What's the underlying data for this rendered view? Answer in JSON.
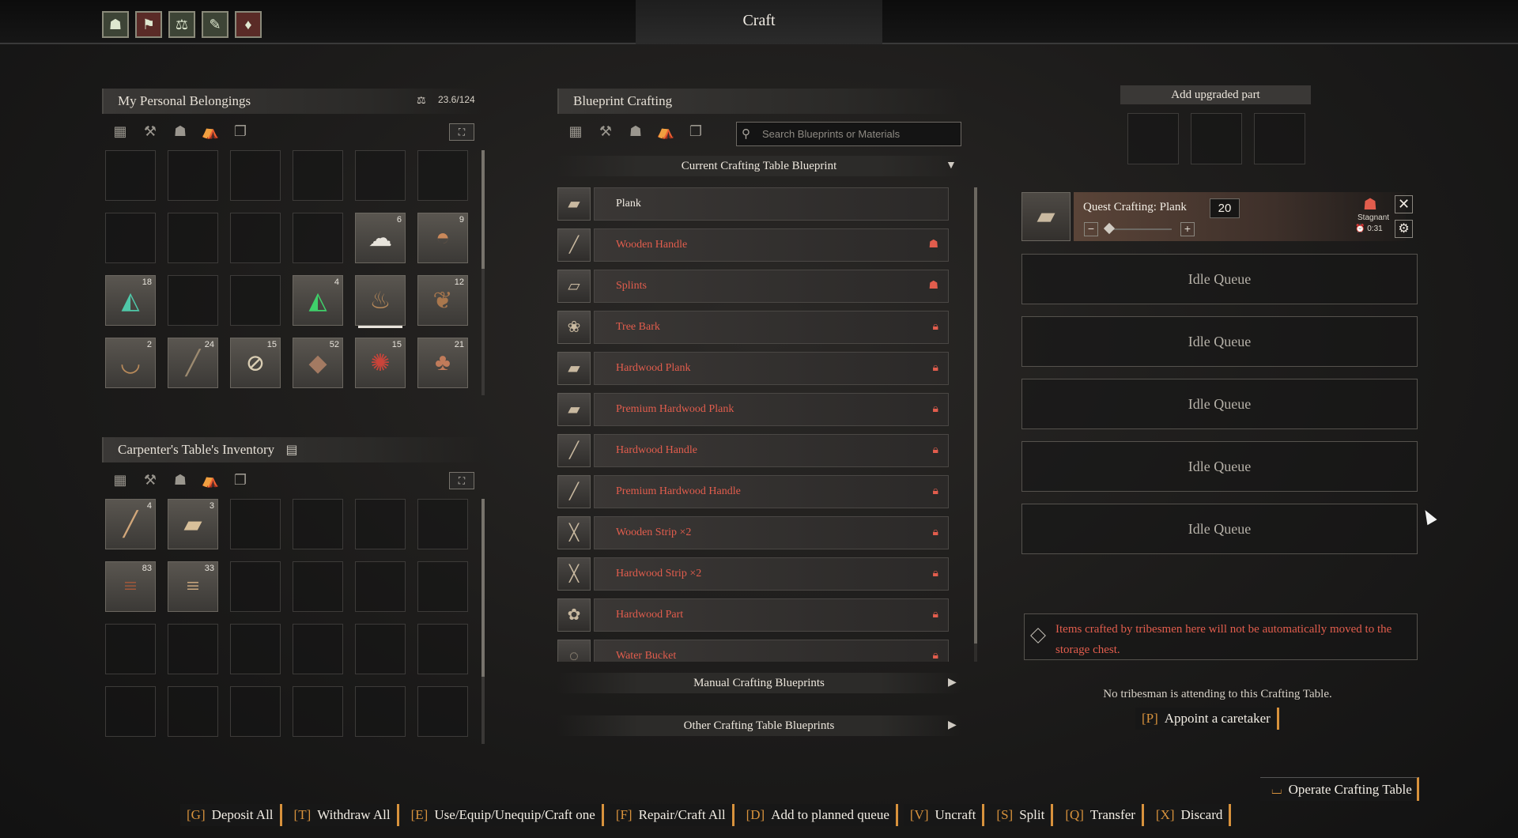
{
  "window_title": "Craft",
  "top_icons": [
    "character-icon",
    "tribe-icon",
    "weight-icon",
    "build-icon",
    "blood-icon"
  ],
  "personal": {
    "title": "My Personal Belongings",
    "weight": "23.6/124",
    "filters": [
      "materials-icon",
      "tools-icon",
      "armor-icon",
      "camp-icon",
      "misc-icon"
    ],
    "slots": [
      {
        "icon": "",
        "count": ""
      },
      {
        "icon": "",
        "count": ""
      },
      {
        "icon": "",
        "count": ""
      },
      {
        "icon": "",
        "count": ""
      },
      {
        "icon": "",
        "count": ""
      },
      {
        "icon": "",
        "count": ""
      },
      {
        "icon": "",
        "count": ""
      },
      {
        "icon": "",
        "count": ""
      },
      {
        "icon": "",
        "count": ""
      },
      {
        "icon": "",
        "count": ""
      },
      {
        "icon": "wool-icon",
        "count": "6"
      },
      {
        "icon": "bowl-icon",
        "count": "9"
      },
      {
        "icon": "crystal-icon",
        "count": "18"
      },
      {
        "icon": "",
        "count": ""
      },
      {
        "icon": "",
        "count": ""
      },
      {
        "icon": "green-crystal-icon",
        "count": "4"
      },
      {
        "icon": "waterskin-icon",
        "count": ""
      },
      {
        "icon": "hide-icon",
        "count": "12"
      },
      {
        "icon": "wooden-bowl-icon",
        "count": "2"
      },
      {
        "icon": "spear-icon",
        "count": "24"
      },
      {
        "icon": "bone-icon",
        "count": "15"
      },
      {
        "icon": "leather-icon",
        "count": "52"
      },
      {
        "icon": "meat-icon",
        "count": "15"
      },
      {
        "icon": "drumstick-icon",
        "count": "21"
      }
    ]
  },
  "carpenter": {
    "title": "Carpenter's Table's Inventory",
    "filters": [
      "materials-icon",
      "tools-icon",
      "armor-icon",
      "camp-icon",
      "misc-icon"
    ],
    "slots": [
      {
        "icon": "handle-icon",
        "count": "4"
      },
      {
        "icon": "plank-icon",
        "count": "3"
      },
      {
        "icon": "",
        "count": ""
      },
      {
        "icon": "",
        "count": ""
      },
      {
        "icon": "",
        "count": ""
      },
      {
        "icon": "",
        "count": ""
      },
      {
        "icon": "logs-icon",
        "count": "83"
      },
      {
        "icon": "hardwood-logs-icon",
        "count": "33"
      },
      {
        "icon": "",
        "count": ""
      },
      {
        "icon": "",
        "count": ""
      },
      {
        "icon": "",
        "count": ""
      },
      {
        "icon": "",
        "count": ""
      },
      {
        "icon": "",
        "count": ""
      },
      {
        "icon": "",
        "count": ""
      },
      {
        "icon": "",
        "count": ""
      },
      {
        "icon": "",
        "count": ""
      },
      {
        "icon": "",
        "count": ""
      },
      {
        "icon": "",
        "count": ""
      },
      {
        "icon": "",
        "count": ""
      },
      {
        "icon": "",
        "count": ""
      },
      {
        "icon": "",
        "count": ""
      },
      {
        "icon": "",
        "count": ""
      },
      {
        "icon": "",
        "count": ""
      },
      {
        "icon": "",
        "count": ""
      }
    ]
  },
  "blueprint": {
    "title": "Blueprint Crafting",
    "search_placeholder": "Search Blueprints or Materials",
    "current_section": "Current Crafting Table Blueprint",
    "items": [
      {
        "name": "Plank",
        "status": "available",
        "badge": ""
      },
      {
        "name": "Wooden Handle",
        "status": "missing",
        "badge": "material-icon"
      },
      {
        "name": "Splints",
        "status": "missing",
        "badge": "material-icon"
      },
      {
        "name": "Tree Bark",
        "status": "locked",
        "badge": "lock-icon"
      },
      {
        "name": "Hardwood Plank",
        "status": "locked",
        "badge": "lock-icon"
      },
      {
        "name": "Premium Hardwood Plank",
        "status": "locked",
        "badge": "lock-icon"
      },
      {
        "name": "Hardwood Handle",
        "status": "locked",
        "badge": "lock-icon"
      },
      {
        "name": "Premium Hardwood Handle",
        "status": "locked",
        "badge": "lock-icon"
      },
      {
        "name": "Wooden Strip ×2",
        "status": "locked",
        "badge": "lock-icon"
      },
      {
        "name": "Hardwood Strip ×2",
        "status": "locked",
        "badge": "lock-icon"
      },
      {
        "name": "Hardwood Part",
        "status": "locked",
        "badge": "lock-icon"
      },
      {
        "name": "Water Bucket",
        "status": "locked",
        "badge": "lock-icon"
      }
    ],
    "manual_section": "Manual Crafting Blueprints",
    "other_section": "Other Crafting Table Blueprints"
  },
  "upgrade": {
    "label": "Add upgraded part"
  },
  "queue": {
    "active": {
      "title": "Quest Crafting: Plank",
      "quantity": "20",
      "status": "Stagnant",
      "timer": "0:31"
    },
    "idle_label": "Idle Queue",
    "idle_count": 5
  },
  "warning": "Items crafted by tribesmen here will not be automatically moved to the storage chest.",
  "caretaker": {
    "text": "No tribesman is attending to this Crafting Table.",
    "key": "[P]",
    "label": "Appoint a caretaker"
  },
  "operate": {
    "key": "⌴",
    "label": "Operate Crafting Table"
  },
  "hotkeys": [
    {
      "key": "[G]",
      "label": "Deposit All"
    },
    {
      "key": "[T]",
      "label": "Withdraw All"
    },
    {
      "key": "[E]",
      "label": "Use/Equip/Unequip/Craft one"
    },
    {
      "key": "[F]",
      "label": "Repair/Craft All"
    },
    {
      "key": "[D]",
      "label": "Add to planned queue"
    },
    {
      "key": "[V]",
      "label": "Uncraft"
    },
    {
      "key": "[S]",
      "label": "Split"
    },
    {
      "key": "[Q]",
      "label": "Transfer"
    },
    {
      "key": "[X]",
      "label": "Discard"
    }
  ],
  "colors": {
    "accent": "#d8923c",
    "locked": "#e25d4d",
    "text": "#f2ede4"
  }
}
